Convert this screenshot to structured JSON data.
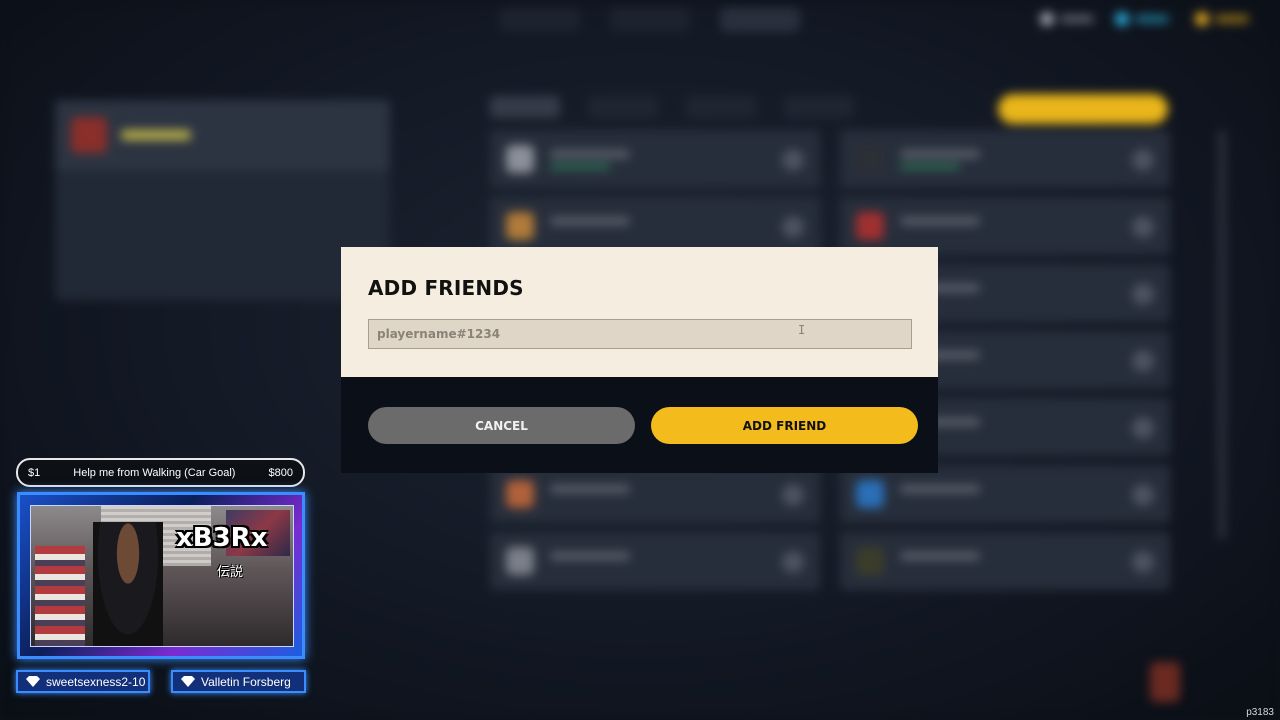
{
  "dialog": {
    "title": "ADD FRIENDS",
    "input_placeholder": "playername#1234",
    "input_value": "",
    "cancel_label": "CANCEL",
    "add_label": "ADD FRIEND"
  },
  "stream_overlay": {
    "goal": {
      "start": "$1",
      "text": "Help me from Walking (Car Goal)",
      "target": "$800"
    },
    "streamer_name": "xB3Rx",
    "streamer_subtitle": "伝説",
    "viewers": [
      "sweetsexness2-10",
      "Valletin Forsberg"
    ]
  },
  "corner_id": "p3183",
  "colors": {
    "accent_yellow": "#f3bb1b",
    "modal_bg": "#f5eee0",
    "overlay_blue": "#3a8dff"
  }
}
